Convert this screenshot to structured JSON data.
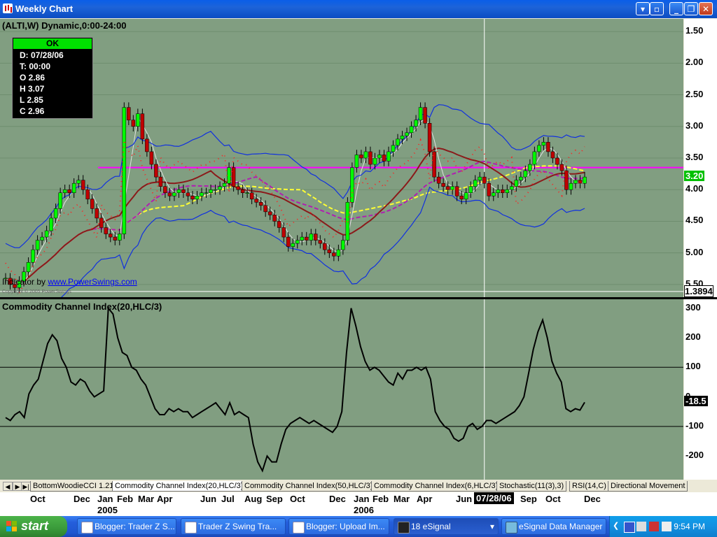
{
  "window": {
    "title": "Weekly Chart",
    "buttons": [
      "menu",
      "restore-inner",
      "minimize",
      "restore",
      "close"
    ]
  },
  "price_panel": {
    "title": "(ALTI,W) Dynamic,0:00-24:00",
    "y_labels": [
      "5.50",
      "5.00",
      "4.50",
      "4.00",
      "3.50",
      "3.00",
      "2.50",
      "2.00",
      "1.50"
    ],
    "current_price": "3.20",
    "cursor_value": "1.3894",
    "attribution_prefix": "Indicator by",
    "attribution_link": "www.PowerSwings.com",
    "copyright": "Copyright © 2005 PowerSwings",
    "ohlc_box": {
      "status": "OK",
      "rows": [
        "D: 07/28/06",
        "T: 00:00",
        "O  2.86",
        "H  3.07",
        "L  2.85",
        "C  2.96"
      ]
    }
  },
  "cci_panel": {
    "title": "Commodity Channel Index(20,HLC/3)",
    "y_labels": [
      "300",
      "200",
      "100",
      "0",
      "-100",
      "-200"
    ],
    "current_value": "-18.5"
  },
  "tabs": {
    "items": [
      "BottomWoodieCCI 1.21",
      "Commodity Channel Index(20,HLC/3)",
      "Commodity Channel Index(50,HLC/3)",
      "Commodity Channel Index(6,HLC/3)",
      "Stochastic(11(3),3)",
      "RSI(14,C)",
      "Directional Movement"
    ],
    "active_index": 1
  },
  "x_axis": {
    "months": [
      "Oct",
      "Dec",
      "Jan",
      "Feb",
      "Mar",
      "Apr",
      "Jun",
      "Jul",
      "Aug",
      "Sep",
      "Oct",
      "Dec",
      "Jan",
      "Feb",
      "Mar",
      "Apr",
      "Jun",
      "Sep",
      "Oct",
      "Dec"
    ],
    "years": [
      "2005",
      "2006"
    ],
    "cursor_date": "07/28/06"
  },
  "taskbar": {
    "start_label": "start",
    "tasks": [
      "Blogger: Trader Z S...",
      "Trader Z Swing Tra...",
      "Blogger: Upload Im...",
      "18 eSignal",
      "eSignal Data Manager"
    ],
    "clock": "9:54 PM"
  },
  "chart_data": [
    {
      "type": "candlestick",
      "title": "(ALTI,W) Dynamic,0:00-24:00",
      "ylim": [
        1.3,
        5.7
      ],
      "yticks": [
        1.5,
        2.0,
        2.5,
        3.0,
        3.5,
        4.0,
        4.5,
        5.0,
        5.5
      ],
      "close_series": [
        1.6,
        1.5,
        1.45,
        1.55,
        1.7,
        1.85,
        2.05,
        2.2,
        2.25,
        2.35,
        2.55,
        2.7,
        2.95,
        3.0,
        2.95,
        3.1,
        3.15,
        3.0,
        2.85,
        2.7,
        2.55,
        2.4,
        2.3,
        2.25,
        2.2,
        2.3,
        4.3,
        4.1,
        4.0,
        4.2,
        3.8,
        3.6,
        3.4,
        3.2,
        3.05,
        2.95,
        2.9,
        2.95,
        3.0,
        2.95,
        2.9,
        2.85,
        2.9,
        2.95,
        2.95,
        3.0,
        3.0,
        3.05,
        3.1,
        3.35,
        3.05,
        3.0,
        2.95,
        2.95,
        2.85,
        2.8,
        2.75,
        2.65,
        2.6,
        2.5,
        2.4,
        2.25,
        2.1,
        2.15,
        2.2,
        2.25,
        2.2,
        2.3,
        2.2,
        2.15,
        2.05,
        2.0,
        1.95,
        2.05,
        2.2,
        2.8,
        3.35,
        3.55,
        3.5,
        3.6,
        3.4,
        3.5,
        3.55,
        3.45,
        3.6,
        3.7,
        3.8,
        3.85,
        3.9,
        4.0,
        4.1,
        4.3,
        4.05,
        3.6,
        3.2,
        3.1,
        3.05,
        3.0,
        3.05,
        2.9,
        2.85,
        2.95,
        3.05,
        3.15,
        3.2,
        3.1,
        2.9,
        2.95,
        3.0,
        2.95,
        3.0,
        3.05,
        3.15,
        3.2,
        3.3,
        3.4,
        3.6,
        3.7,
        3.75,
        3.6,
        3.5,
        3.4,
        3.3,
        3.0,
        3.1,
        3.15,
        3.1,
        3.2
      ],
      "current_price": 3.2
    },
    {
      "type": "line",
      "title": "Commodity Channel Index(20,HLC/3)",
      "ylim": [
        -280,
        330
      ],
      "yticks": [
        300,
        200,
        100,
        0,
        -100,
        -200
      ],
      "reference_lines": [
        100,
        -100
      ],
      "series": [
        {
          "name": "Commodity Channel Index(20,HLC/3)",
          "values": [
            -70,
            -80,
            -60,
            -50,
            -70,
            10,
            40,
            60,
            120,
            180,
            210,
            190,
            130,
            100,
            50,
            40,
            60,
            50,
            20,
            0,
            10,
            20,
            300,
            280,
            200,
            150,
            140,
            100,
            90,
            60,
            40,
            0,
            -40,
            -60,
            -60,
            -40,
            -50,
            -40,
            -50,
            -50,
            -70,
            -60,
            -50,
            -40,
            -30,
            -20,
            -40,
            -60,
            -20,
            -60,
            -50,
            -60,
            -70,
            -160,
            -220,
            -250,
            -200,
            -220,
            -220,
            -160,
            -110,
            -90,
            -80,
            -70,
            -80,
            -90,
            -80,
            -90,
            -100,
            -110,
            -120,
            -100,
            -50,
            150,
            300,
            240,
            170,
            120,
            90,
            100,
            90,
            70,
            50,
            40,
            80,
            60,
            90,
            90,
            100,
            90,
            100,
            60,
            -50,
            -80,
            -100,
            -110,
            -140,
            -150,
            -140,
            -100,
            -90,
            -110,
            -100,
            -80,
            -80,
            -90,
            -80,
            -70,
            -60,
            -50,
            -30,
            0,
            80,
            160,
            220,
            260,
            200,
            120,
            80,
            50,
            -40,
            -50,
            -40,
            -45,
            -18.5
          ]
        }
      ],
      "current_value": -18.5
    }
  ]
}
